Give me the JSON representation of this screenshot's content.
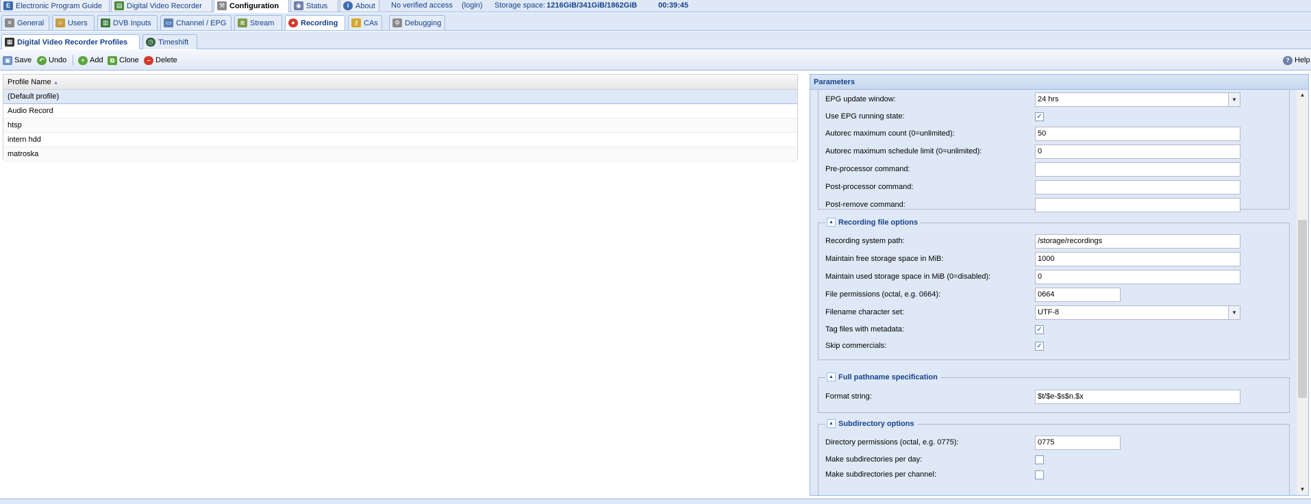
{
  "top_tabs": [
    {
      "label": "Electronic Program Guide",
      "icon": "epg-icon"
    },
    {
      "label": "Digital Video Recorder",
      "icon": "dvr-icon"
    },
    {
      "label": "Configuration",
      "icon": "wrench-icon"
    },
    {
      "label": "Status",
      "icon": "eye-icon"
    },
    {
      "label": "About",
      "icon": "info-icon"
    }
  ],
  "status": {
    "access": "No verified access",
    "login": "(login)",
    "storage_label": "Storage space:",
    "storage_value": "1216GiB/341GiB/1862GiB",
    "time": "00:39:45"
  },
  "config_tabs": [
    {
      "label": "General",
      "icon": "tools-icon"
    },
    {
      "label": "Users",
      "icon": "users-icon"
    },
    {
      "label": "DVB Inputs",
      "icon": "card-icon"
    },
    {
      "label": "Channel / EPG",
      "icon": "tv-icon"
    },
    {
      "label": "Stream",
      "icon": "stream-icon"
    },
    {
      "label": "Recording",
      "icon": "record-icon"
    },
    {
      "label": "CAs",
      "icon": "key-icon"
    },
    {
      "label": "Debugging",
      "icon": "bug-icon"
    }
  ],
  "recording_tabs": [
    {
      "label": "Digital Video Recorder Profiles",
      "icon": "dvr-profile-icon"
    },
    {
      "label": "Timeshift",
      "icon": "timeshift-icon"
    }
  ],
  "toolbar": {
    "save": "Save",
    "undo": "Undo",
    "add": "Add",
    "clone": "Clone",
    "delete": "Delete",
    "help": "Help"
  },
  "grid": {
    "column": "Profile Name",
    "rows": [
      "(Default profile)",
      "Audio Record",
      "htsp",
      "intern hdd",
      "matroska"
    ]
  },
  "panel": {
    "title": "Parameters",
    "general_fields": [
      {
        "label": "EPG update window:",
        "value": "24 hrs"
      },
      {
        "label": "Use EPG running state:",
        "checked": true
      },
      {
        "label": "Autorec maximum count (0=unlimited):",
        "value": "50"
      },
      {
        "label": "Autorec maximum schedule limit (0=unlimited):",
        "value": "0"
      },
      {
        "label": "Pre-processor command:",
        "value": ""
      },
      {
        "label": "Post-processor command:",
        "value": ""
      },
      {
        "label": "Post-remove command:",
        "value": ""
      }
    ],
    "recording_file": {
      "legend": "Recording file options",
      "fields": [
        {
          "label": "Recording system path:",
          "value": "/storage/recordings"
        },
        {
          "label": "Maintain free storage space in MiB:",
          "value": "1000"
        },
        {
          "label": "Maintain used storage space in MiB (0=disabled):",
          "value": "0"
        },
        {
          "label": "File permissions (octal, e.g. 0664):",
          "value": "0664"
        },
        {
          "label": "Filename character set:",
          "value": "UTF-8"
        },
        {
          "label": "Tag files with metadata:",
          "checked": true
        },
        {
          "label": "Skip commercials:",
          "checked": true
        }
      ]
    },
    "pathname": {
      "legend": "Full pathname specification",
      "fields": [
        {
          "label": "Format string:",
          "value": "$t/$e-$s$n.$x"
        }
      ]
    },
    "subdirectory": {
      "legend": "Subdirectory options",
      "fields": [
        {
          "label": "Directory permissions (octal, e.g. 0775):",
          "value": "0775"
        },
        {
          "label": "Make subdirectories per day:",
          "checked": false
        },
        {
          "label": "Make subdirectories per channel:",
          "checked": false
        }
      ]
    }
  }
}
